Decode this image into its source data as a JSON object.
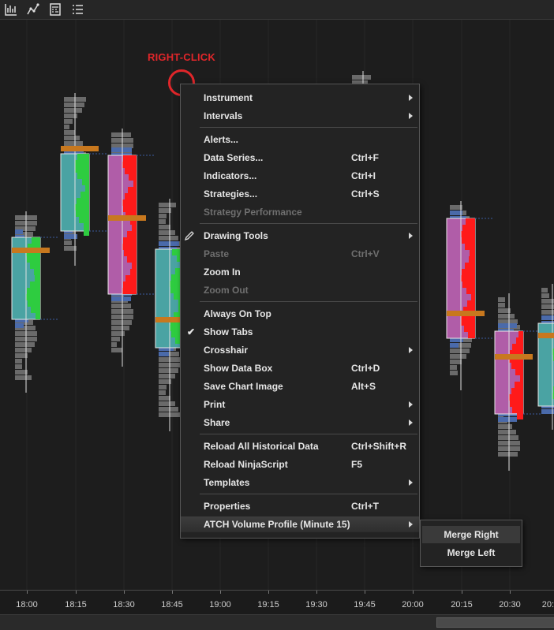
{
  "toolbar": {
    "buttons": [
      {
        "name": "bar-chart-icon"
      },
      {
        "name": "drawing-tool-icon"
      },
      {
        "name": "calculator-icon"
      },
      {
        "name": "list-icon"
      }
    ]
  },
  "annotation": {
    "text": "RIGHT-CLICK",
    "color": "#e0262a"
  },
  "context_menu": {
    "items": [
      {
        "label": "Instrument",
        "shortcut": "",
        "submenu": true,
        "disabled": false
      },
      {
        "label": "Intervals",
        "shortcut": "",
        "submenu": true,
        "disabled": false
      },
      {
        "label": "Alerts...",
        "shortcut": "",
        "submenu": false,
        "disabled": false
      },
      {
        "label": "Data Series...",
        "shortcut": "Ctrl+F",
        "submenu": false,
        "disabled": false
      },
      {
        "label": "Indicators...",
        "shortcut": "Ctrl+I",
        "submenu": false,
        "disabled": false
      },
      {
        "label": "Strategies...",
        "shortcut": "Ctrl+S",
        "submenu": false,
        "disabled": false
      },
      {
        "label": "Strategy Performance",
        "shortcut": "",
        "submenu": false,
        "disabled": true
      },
      {
        "label": "Drawing Tools",
        "shortcut": "",
        "submenu": true,
        "disabled": false,
        "icon": "pencil-icon"
      },
      {
        "label": "Paste",
        "shortcut": "Ctrl+V",
        "submenu": false,
        "disabled": true
      },
      {
        "label": "Zoom In",
        "shortcut": "",
        "submenu": false,
        "disabled": false
      },
      {
        "label": "Zoom Out",
        "shortcut": "",
        "submenu": false,
        "disabled": true
      },
      {
        "label": "Always On Top",
        "shortcut": "",
        "submenu": false,
        "disabled": false
      },
      {
        "label": "Show Tabs",
        "shortcut": "",
        "submenu": false,
        "disabled": false,
        "checked": true
      },
      {
        "label": "Crosshair",
        "shortcut": "",
        "submenu": true,
        "disabled": false
      },
      {
        "label": "Show Data Box",
        "shortcut": "Ctrl+D",
        "submenu": false,
        "disabled": false
      },
      {
        "label": "Save Chart Image",
        "shortcut": "Alt+S",
        "submenu": false,
        "disabled": false
      },
      {
        "label": "Print",
        "shortcut": "",
        "submenu": true,
        "disabled": false
      },
      {
        "label": "Share",
        "shortcut": "",
        "submenu": true,
        "disabled": false
      },
      {
        "label": "Reload All Historical Data",
        "shortcut": "Ctrl+Shift+R",
        "submenu": false,
        "disabled": false
      },
      {
        "label": "Reload NinjaScript",
        "shortcut": "F5",
        "submenu": false,
        "disabled": false
      },
      {
        "label": "Templates",
        "shortcut": "",
        "submenu": true,
        "disabled": false
      },
      {
        "label": "Properties",
        "shortcut": "Ctrl+T",
        "submenu": false,
        "disabled": false
      },
      {
        "label": "ATCH Volume Profile (Minute 15)",
        "shortcut": "",
        "submenu": true,
        "disabled": false,
        "highlighted": true
      }
    ]
  },
  "submenu": {
    "items": [
      {
        "label": "Merge Right",
        "highlighted": true
      },
      {
        "label": "Merge Left",
        "highlighted": false
      }
    ]
  },
  "time_axis": {
    "labels": [
      "18:00",
      "18:15",
      "18:30",
      "18:45",
      "19:00",
      "19:15",
      "19:30",
      "19:45",
      "20:00",
      "20:15",
      "20:30",
      "20:"
    ]
  },
  "colors": {
    "bullish": "#2ecc40",
    "bearish": "#ff1a1a",
    "value_area_up": "#4aa3a3",
    "value_area_down": "#b05da8",
    "poc": "#c8781e",
    "profile_gray": "#6a6a6a",
    "profile_blue": "#4a6aaa"
  }
}
